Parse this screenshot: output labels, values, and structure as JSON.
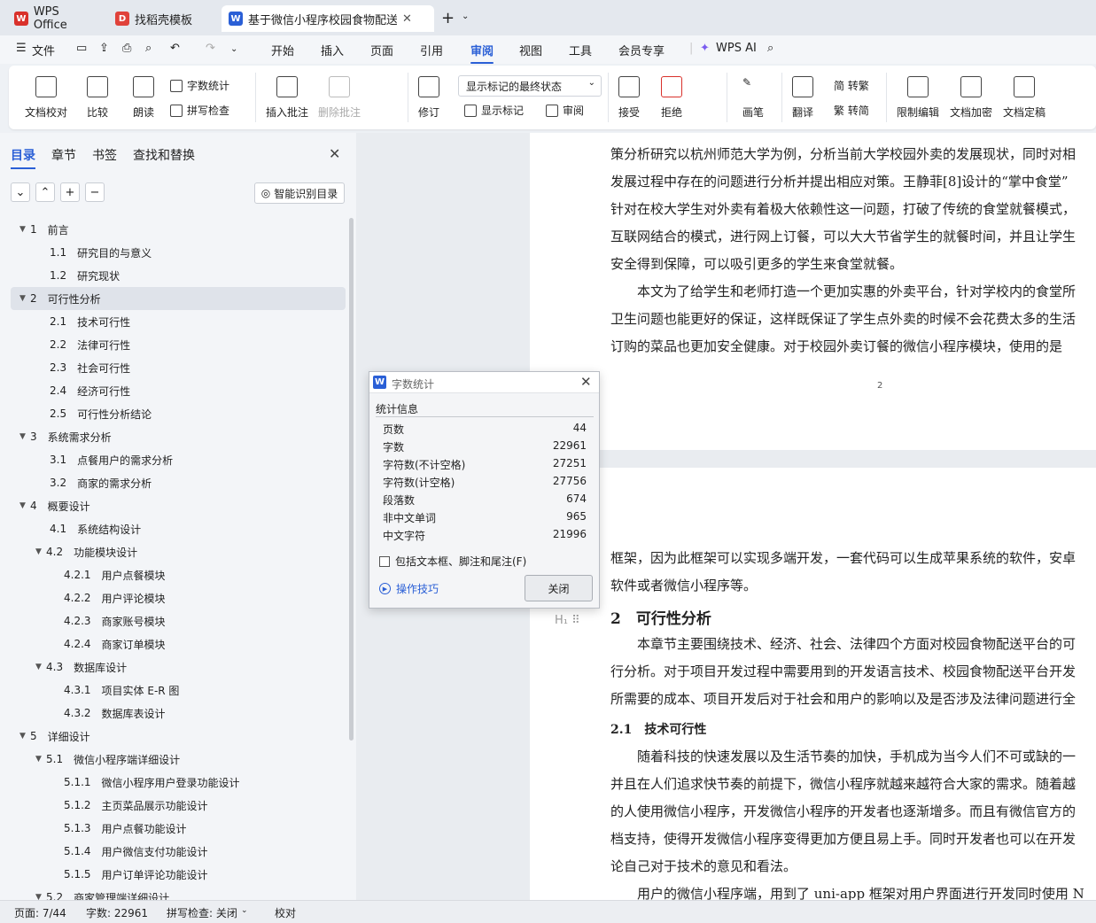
{
  "tabs": [
    {
      "label": "WPS Office",
      "icon": "wps-logo-icon"
    },
    {
      "label": "找稻壳模板",
      "icon": "docer-icon"
    },
    {
      "label": "基于微信小程序校园食物配送",
      "icon": "word-doc-icon"
    }
  ],
  "menu": {
    "file_label": "文件",
    "items": [
      "开始",
      "插入",
      "页面",
      "引用",
      "审阅",
      "视图",
      "工具",
      "会员专享"
    ],
    "active": "审阅",
    "wps_ai": "WPS AI"
  },
  "ribbon": {
    "doc_check": "文档校对",
    "compare": "比较",
    "read_aloud": "朗读",
    "word_count": "字数统计",
    "spell_check": "拼写检查",
    "insert_comment": "插入批注",
    "delete_comment": "删除批注",
    "track": "修订",
    "mark_state": "显示标记的最终状态",
    "show_marks": "显示标记",
    "review": "审阅",
    "accept": "接受",
    "reject": "拒绝",
    "pen": "画笔",
    "translate": "翻译",
    "trad": "简 转繁",
    "simp": "繁 转简",
    "restrict": "限制编辑",
    "encrypt": "文档加密",
    "finalize": "文档定稿"
  },
  "sidebar": {
    "tabs": [
      "目录",
      "章节",
      "书签",
      "查找和替换"
    ],
    "smart_btn": "智能识别目录",
    "toc": [
      {
        "num": "1",
        "title": "前言",
        "lvl": 0,
        "arrow": true
      },
      {
        "num": "1.1",
        "title": "研究目的与意义",
        "lvl": 1
      },
      {
        "num": "1.2",
        "title": "研究现状",
        "lvl": 1
      },
      {
        "num": "2",
        "title": "可行性分析",
        "lvl": 0,
        "arrow": true,
        "sel": true
      },
      {
        "num": "2.1",
        "title": "技术可行性",
        "lvl": 1
      },
      {
        "num": "2.2",
        "title": "法律可行性",
        "lvl": 1
      },
      {
        "num": "2.3",
        "title": "社会可行性",
        "lvl": 1
      },
      {
        "num": "2.4",
        "title": "经济可行性",
        "lvl": 1
      },
      {
        "num": "2.5",
        "title": "可行性分析结论",
        "lvl": 1
      },
      {
        "num": "3",
        "title": "系统需求分析",
        "lvl": 0,
        "arrow": true
      },
      {
        "num": "3.1",
        "title": "点餐用户的需求分析",
        "lvl": 1
      },
      {
        "num": "3.2",
        "title": "商家的需求分析",
        "lvl": 1
      },
      {
        "num": "4",
        "title": "概要设计",
        "lvl": 0,
        "arrow": true
      },
      {
        "num": "4.1",
        "title": "系统结构设计",
        "lvl": 1
      },
      {
        "num": "4.2",
        "title": "功能模块设计",
        "lvl": 1,
        "arrow": true
      },
      {
        "num": "4.2.1",
        "title": "用户点餐模块",
        "lvl": 2
      },
      {
        "num": "4.2.2",
        "title": "用户评论模块",
        "lvl": 2
      },
      {
        "num": "4.2.3",
        "title": "商家账号模块",
        "lvl": 2
      },
      {
        "num": "4.2.4",
        "title": "商家订单模块",
        "lvl": 2
      },
      {
        "num": "4.3",
        "title": "数据库设计",
        "lvl": 1,
        "arrow": true
      },
      {
        "num": "4.3.1",
        "title": "项目实体 E-R 图",
        "lvl": 2
      },
      {
        "num": "4.3.2",
        "title": "数据库表设计",
        "lvl": 2
      },
      {
        "num": "5",
        "title": "详细设计",
        "lvl": 0,
        "arrow": true
      },
      {
        "num": "5.1",
        "title": "微信小程序端详细设计",
        "lvl": 1,
        "arrow": true
      },
      {
        "num": "5.1.1",
        "title": "微信小程序用户登录功能设计",
        "lvl": 2
      },
      {
        "num": "5.1.2",
        "title": "主页菜品展示功能设计",
        "lvl": 2
      },
      {
        "num": "5.1.3",
        "title": "用户点餐功能设计",
        "lvl": 2
      },
      {
        "num": "5.1.4",
        "title": "用户微信支付功能设计",
        "lvl": 2
      },
      {
        "num": "5.1.5",
        "title": "用户订单评论功能设计",
        "lvl": 2
      },
      {
        "num": "5.2",
        "title": "商家管理端详细设计",
        "lvl": 1,
        "arrow": true
      }
    ]
  },
  "doc": {
    "page1_lines": [
      "策分析研究以杭州师范大学为例，分析当前大学校园外卖的发展现状，同时对相",
      "发展过程中存在的问题进行分析并提出相应对策。王静菲[8]设计的“掌中食堂”",
      "针对在校大学生对外卖有着极大依赖性这一问题，打破了传统的食堂就餐模式，",
      "互联网结合的模式，进行网上订餐，可以大大节省学生的就餐时间，并且让学生",
      "安全得到保障，可以吸引更多的学生来食堂就餐。",
      "　　本文为了给学生和老师打造一个更加实惠的外卖平台，针对学校内的食堂所",
      "卫生问题也能更好的保证，这样既保证了学生点外卖的时候不会花费太多的生活",
      "订购的菜品也更加安全健康。对于校园外卖订餐的微信小程序模块，使用的是"
    ],
    "page_number": "2",
    "page2_lines": [
      "框架，因为此框架可以实现多端开发，一套代码可以生成苹果系统的软件，安卓",
      "软件或者微信小程序等。"
    ],
    "heading2": "2　可行性分析",
    "para2": [
      "　　本章节主要围绕技术、经济、社会、法律四个方面对校园食物配送平台的可",
      "行分析。对于项目开发过程中需要用到的开发语言技术、校园食物配送平台开发",
      "所需要的成本、项目开发后对于社会和用户的影响以及是否涉及法律问题进行全"
    ],
    "heading3": "2.1　技术可行性",
    "para3": [
      "　　随着科技的快速发展以及生活节奏的加快，手机成为当今人们不可或缺的一",
      "并且在人们追求快节奏的前提下，微信小程序就越来越符合大家的需求。随着越",
      "的人使用微信小程序，开发微信小程序的开发者也逐渐增多。而且有微信官方的",
      "档支持，使得开发微信小程序变得更加方便且易上手。同时开发者也可以在开发",
      "论自己对于技术的意见和看法。",
      "　　用户的微信小程序端，用到了 uni-app 框架对用户界面进行开发同时使用 N"
    ]
  },
  "dialog": {
    "title": "字数统计",
    "section": "统计信息",
    "stats": [
      {
        "label": "页数",
        "value": "44"
      },
      {
        "label": "字数",
        "value": "22961"
      },
      {
        "label": "字符数(不计空格)",
        "value": "27251"
      },
      {
        "label": "字符数(计空格)",
        "value": "27756"
      },
      {
        "label": "段落数",
        "value": "674"
      },
      {
        "label": "非中文单词",
        "value": "965"
      },
      {
        "label": "中文字符",
        "value": "21996"
      }
    ],
    "checkbox_label": "包括文本框、脚注和尾注(F)",
    "tips_link": "操作技巧",
    "close_label": "关闭"
  },
  "status": {
    "page": "页面: 7/44",
    "words": "字数: 22961",
    "spell": "拼写检查: 关闭",
    "proof": "校对"
  },
  "colors": {
    "accent": "#2a5fd6",
    "wps_red": "#d9312b"
  }
}
